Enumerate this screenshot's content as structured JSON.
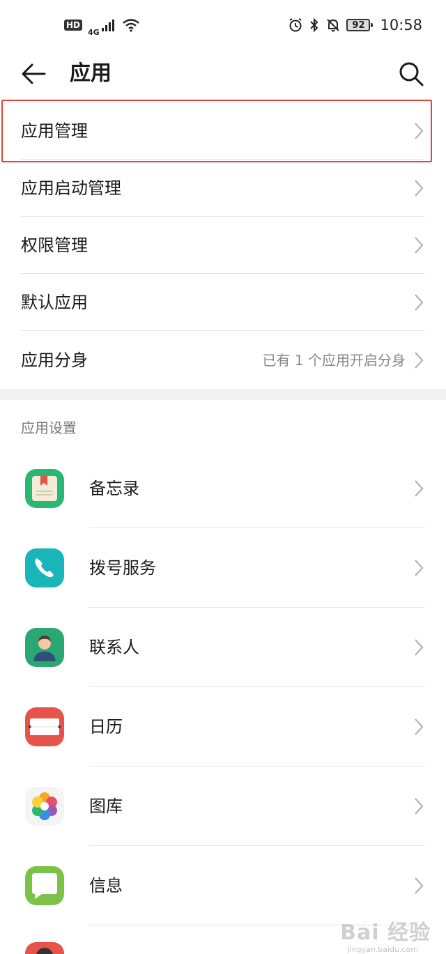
{
  "status_bar": {
    "hd": "HD",
    "network": "4G",
    "battery": "92",
    "time": "10:58"
  },
  "header": {
    "title": "应用"
  },
  "menu": [
    {
      "label": "应用管理"
    },
    {
      "label": "应用启动管理"
    },
    {
      "label": "权限管理"
    },
    {
      "label": "默认应用"
    },
    {
      "label": "应用分身",
      "value": "已有 1 个应用开启分身"
    }
  ],
  "section": {
    "title": "应用设置"
  },
  "apps": [
    {
      "label": "备忘录",
      "icon": "notepad-icon"
    },
    {
      "label": "拨号服务",
      "icon": "phone-icon"
    },
    {
      "label": "联系人",
      "icon": "contacts-icon"
    },
    {
      "label": "日历",
      "icon": "calendar-icon"
    },
    {
      "label": "图库",
      "icon": "gallery-icon"
    },
    {
      "label": "信息",
      "icon": "messages-icon"
    }
  ],
  "watermark": {
    "text": "Bai 经验",
    "sub": "jingyan.baidu.com"
  },
  "colors": {
    "highlight": "#e0463a",
    "notepad": "#2bb673",
    "phone": "#19b5b8",
    "contacts": "#2aa772",
    "calendar": "#e5534b",
    "messages": "#7cc24a"
  }
}
